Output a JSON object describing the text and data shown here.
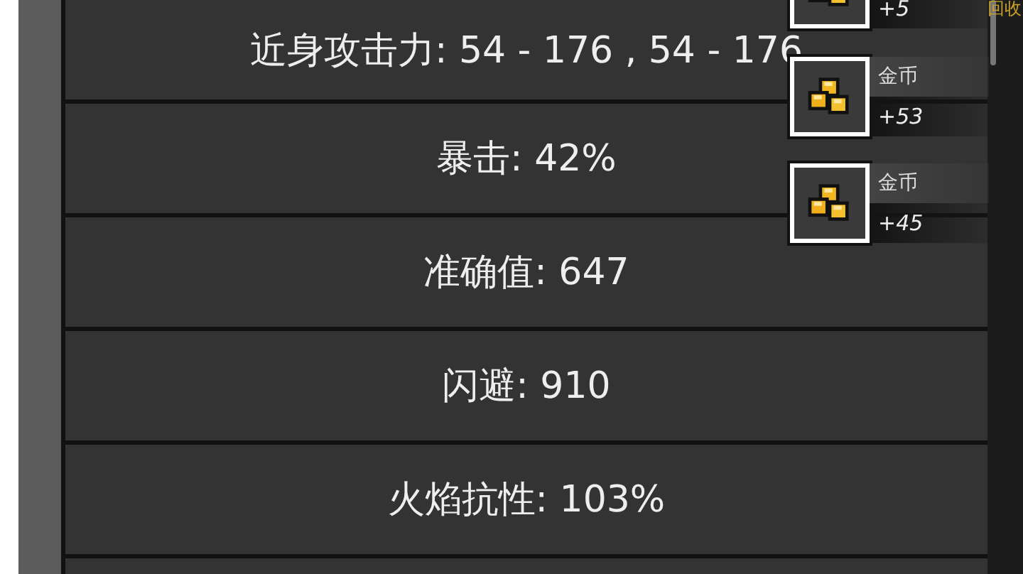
{
  "stats": [
    {
      "text": "近身攻击力: 54 - 176 , 54 - 176"
    },
    {
      "text": "暴击: 42%"
    },
    {
      "text": "准确值: 647"
    },
    {
      "text": "闪避: 910"
    },
    {
      "text": "火焰抗性: 103%"
    }
  ],
  "loot": [
    {
      "value": "+5"
    },
    {
      "label": "金币",
      "value": "+53"
    },
    {
      "label": "金币",
      "value": "+45"
    }
  ],
  "recycle": "回收"
}
